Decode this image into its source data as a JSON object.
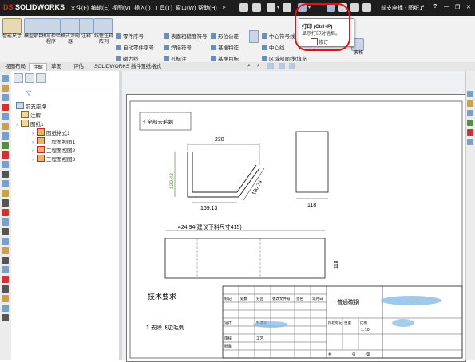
{
  "app": {
    "logo_ds": "DS",
    "logo_text": "SOLIDWORKS",
    "menu": [
      "文件(F)",
      "编辑(E)",
      "视图(V)",
      "插入(I)",
      "工具(T)",
      "窗口(W)",
      "帮助(H)"
    ],
    "document_title": "前支座撑 - 图纸1",
    "help_symbol": "?"
  },
  "tooltip": {
    "title": "打印 (Ctrl+P)",
    "description": "显示打印对话框。",
    "checkbox_label": "修订"
  },
  "command_manager": {
    "big_buttons": [
      "智能尺寸",
      "模型项目",
      "拼写检验程序",
      "格式涂刷器",
      "注释",
      "线性注释阵列"
    ],
    "rows": [
      [
        "零件序号",
        "自动零件序号",
        "磁力线"
      ],
      [
        "表面粗糙度符号",
        "焊接符号",
        "孔标注"
      ],
      [
        "形位公差",
        "基准特征",
        "基准目标"
      ],
      [
        "中心符号线",
        "中心线",
        "区域剖面线/填充"
      ]
    ],
    "extra_label": "表格"
  },
  "tabs": [
    "视图布局",
    "注解",
    "草图",
    "评估",
    "SOLIDWORKS 插件",
    "图纸格式"
  ],
  "active_tab_index": 1,
  "feature_tree": {
    "root": "前支座撑",
    "items": [
      {
        "label": "注解",
        "level": 1,
        "expandable": false
      },
      {
        "label": "图纸1",
        "level": 1,
        "expandable": true
      },
      {
        "label": "图纸格式1",
        "level": 2,
        "expandable": true
      },
      {
        "label": "工程图视图1",
        "level": 2,
        "expandable": true
      },
      {
        "label": "工程图视图2",
        "level": 2,
        "expandable": true
      },
      {
        "label": "工程图视图3",
        "level": 2,
        "expandable": true
      }
    ]
  },
  "drawing": {
    "roughness_note": "√ 全部去毛刺",
    "dims": {
      "top_width": "230",
      "bottom_width": "169.13",
      "left_height": "120.43",
      "right_height": "150.74",
      "side_width": "118",
      "flat_length": "424.94(建议下料尺寸415)",
      "flat_height": "118"
    },
    "tech_req_title": "技术要求",
    "tech_req_item": "1.去除飞边毛刺",
    "title_block": {
      "part_type": "普通碳钢",
      "scale": "1:10",
      "cells": [
        "标记",
        "处数",
        "分区",
        "更改文件号",
        "签名",
        "年月日",
        "设计",
        "标准化",
        "阶段标记",
        "重量",
        "比例",
        "审核",
        "工艺",
        "批准",
        "共",
        "张",
        "第"
      ]
    }
  },
  "colors": {
    "highlight": "#e0111b",
    "title_bar": "#1d1d1d",
    "blur": "#7fb6e6"
  }
}
